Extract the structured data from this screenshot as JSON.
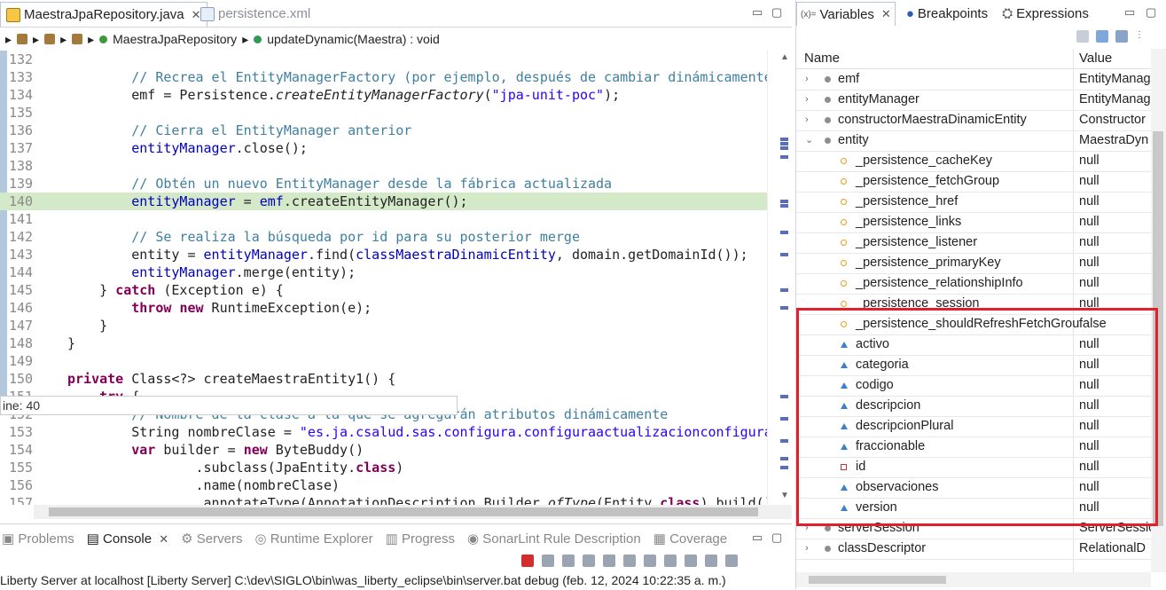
{
  "editor": {
    "tabs": [
      {
        "label": "MaestraJpaRepository.java",
        "active": true
      },
      {
        "label": "persistence.xml",
        "active": false
      }
    ],
    "breadcrumb": {
      "class": "MaestraJpaRepository",
      "method": "updateDynamic(Maestra) : void"
    },
    "tooltip": "ine: 40",
    "lines": [
      {
        "num": "132",
        "html": ""
      },
      {
        "num": "133",
        "html": "<span class=\"cm\">        // Recrea el EntityManagerFactory (por ejemplo, después de cambiar dinámicamente</span>"
      },
      {
        "num": "134",
        "html": "        emf = Persistence.<span class=\"it\">createEntityManagerFactory</span>(<span class=\"str\">\"jpa-unit-poc\"</span>);"
      },
      {
        "num": "135",
        "html": ""
      },
      {
        "num": "136",
        "html": "<span class=\"cm\">        // Cierra el EntityManager anterior</span>"
      },
      {
        "num": "137",
        "html": "        <span class=\"fld\">entityManager</span>.close();"
      },
      {
        "num": "138",
        "html": ""
      },
      {
        "num": "139",
        "html": "<span class=\"cm\">        // Obtén un nuevo EntityManager desde la fábrica actualizada</span>"
      },
      {
        "num": "140",
        "html": "        <span class=\"fld\">entityManager</span> = <span class=\"fld\">emf</span>.createEntityManager();",
        "current": true
      },
      {
        "num": "141",
        "html": ""
      },
      {
        "num": "142",
        "html": "<span class=\"cm\">        // Se realiza la búsqueda por id para su posterior merge</span>"
      },
      {
        "num": "143",
        "html": "        entity = <span class=\"fld\">entityManager</span>.find(<span class=\"fld\">classMaestraDinamicEntity</span>, domain.getDomainId());"
      },
      {
        "num": "144",
        "html": "        <span class=\"fld\">entityManager</span>.merge(entity);"
      },
      {
        "num": "145",
        "html": "    } <span class=\"kw\">catch</span> (Exception e) {"
      },
      {
        "num": "146",
        "html": "        <span class=\"kw\">throw</span> <span class=\"kw\">new</span> RuntimeException(e);"
      },
      {
        "num": "147",
        "html": "    }"
      },
      {
        "num": "148",
        "html": "}"
      },
      {
        "num": "149",
        "html": ""
      },
      {
        "num": "150",
        "html": "<span class=\"kw\">private</span> Class&lt;?&gt; createMaestraEntity1() {"
      },
      {
        "num": "151",
        "html": "    <span class=\"kw\">try</span> {"
      },
      {
        "num": "152",
        "html": "<span class=\"cm\">        // Nombre de la clase a la que se agregarán atributos dinámicamente</span>"
      },
      {
        "num": "153",
        "html": "        String nombreClase = <span class=\"str\">\"es.ja.csalud.sas.configura.configuraactualizacionconfigura</span>"
      },
      {
        "num": "154",
        "html": "        <span class=\"kw\">var</span> builder = <span class=\"kw\">new</span> ByteBuddy()"
      },
      {
        "num": "155",
        "html": "                .subclass(JpaEntity.<span class=\"kw\">class</span>)"
      },
      {
        "num": "156",
        "html": "                .name(nombreClase)"
      },
      {
        "num": "157",
        "html": "                .annotateType(AnnotationDescription.Builder.<span class=\"it\">ofType</span>(Entity.<span class=\"kw\">class</span>).build()"
      }
    ]
  },
  "console": {
    "tabs": [
      {
        "label": "Problems",
        "active": false
      },
      {
        "label": "Console",
        "active": true
      },
      {
        "label": "Servers",
        "active": false
      },
      {
        "label": "Runtime Explorer",
        "active": false
      },
      {
        "label": "Progress",
        "active": false
      },
      {
        "label": "SonarLint Rule Description",
        "active": false
      },
      {
        "label": "Coverage",
        "active": false
      }
    ],
    "status": "Liberty Server at localhost [Liberty Server] C:\\dev\\SIGLO\\bin\\was_liberty_eclipse\\bin\\server.bat debug (feb. 12, 2024 10:22:35 a. m.)"
  },
  "variables": {
    "tabs": [
      "Variables",
      "Breakpoints",
      "Expressions"
    ],
    "columns": {
      "name": "Name",
      "value": "Value"
    },
    "rows": [
      {
        "indent": 0,
        "expander": "›",
        "icon": "gray",
        "name": "emf",
        "value": "EntityManag"
      },
      {
        "indent": 0,
        "expander": "›",
        "icon": "gray",
        "name": "entityManager",
        "value": "EntityManag"
      },
      {
        "indent": 0,
        "expander": "›",
        "icon": "gray",
        "name": "constructorMaestraDinamicEntity",
        "value": "Constructor"
      },
      {
        "indent": 0,
        "expander": "⌄",
        "icon": "gray",
        "name": "entity",
        "value": "MaestraDyn"
      },
      {
        "indent": 1,
        "expander": "",
        "icon": "orange",
        "name": "_persistence_cacheKey",
        "value": "null"
      },
      {
        "indent": 1,
        "expander": "",
        "icon": "orange",
        "name": "_persistence_fetchGroup",
        "value": "null"
      },
      {
        "indent": 1,
        "expander": "",
        "icon": "orange",
        "name": "_persistence_href",
        "value": "null"
      },
      {
        "indent": 1,
        "expander": "",
        "icon": "orange",
        "name": "_persistence_links",
        "value": "null"
      },
      {
        "indent": 1,
        "expander": "",
        "icon": "orange",
        "name": "_persistence_listener",
        "value": "null"
      },
      {
        "indent": 1,
        "expander": "",
        "icon": "orange",
        "name": "_persistence_primaryKey",
        "value": "null"
      },
      {
        "indent": 1,
        "expander": "",
        "icon": "orange",
        "name": "_persistence_relationshipInfo",
        "value": "null"
      },
      {
        "indent": 1,
        "expander": "",
        "icon": "orange",
        "name": "_persistence_session",
        "value": "null"
      },
      {
        "indent": 1,
        "expander": "",
        "icon": "orange",
        "name": "_persistence_shouldRefreshFetchGrou",
        "value": "false"
      },
      {
        "indent": 1,
        "expander": "",
        "icon": "tri",
        "name": "activo",
        "value": "null"
      },
      {
        "indent": 1,
        "expander": "",
        "icon": "tri",
        "name": "categoria",
        "value": "null"
      },
      {
        "indent": 1,
        "expander": "",
        "icon": "tri",
        "name": "codigo",
        "value": "null"
      },
      {
        "indent": 1,
        "expander": "",
        "icon": "tri",
        "name": "descripcion",
        "value": "null"
      },
      {
        "indent": 1,
        "expander": "",
        "icon": "tri",
        "name": "descripcionPlural",
        "value": "null"
      },
      {
        "indent": 1,
        "expander": "",
        "icon": "tri",
        "name": "fraccionable",
        "value": "null"
      },
      {
        "indent": 1,
        "expander": "",
        "icon": "redsq",
        "name": "id",
        "value": "null"
      },
      {
        "indent": 1,
        "expander": "",
        "icon": "tri",
        "name": "observaciones",
        "value": "null"
      },
      {
        "indent": 1,
        "expander": "",
        "icon": "tri",
        "name": "version",
        "value": "null"
      },
      {
        "indent": 0,
        "expander": "›",
        "icon": "gray",
        "name": "serverSession",
        "value": "ServerSessio"
      },
      {
        "indent": 0,
        "expander": "›",
        "icon": "gray",
        "name": "classDescriptor",
        "value": "RelationalD"
      }
    ],
    "highlight_color": "#e0202a"
  }
}
